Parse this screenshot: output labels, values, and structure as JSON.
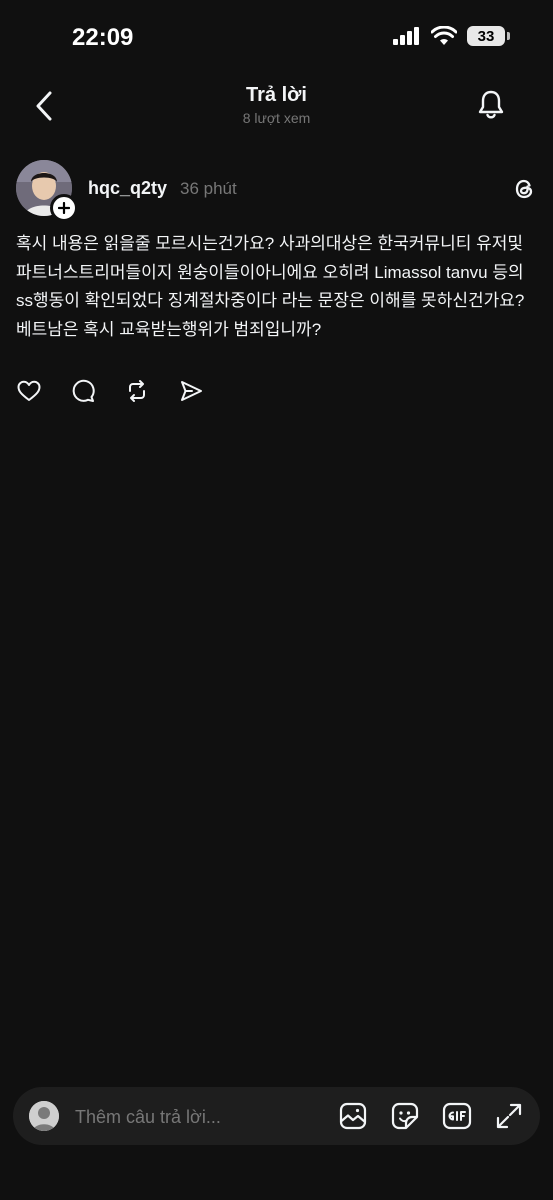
{
  "status_bar": {
    "time": "22:09",
    "battery": "33"
  },
  "header": {
    "title": "Trả lời",
    "subtitle": "8 lượt xem"
  },
  "post": {
    "username": "hqc_q2ty",
    "time": "36 phút",
    "text": "혹시 내용은 읽을줄 모르시는건가요? 사과의대상은 한국커뮤니티 유저및 파트너스트리머들이지 원숭이들이아니에요 오히려 Limassol tanvu 등의 ss행동이 확인되었다 징계절차중이다 라는 문장은 이해를 못하신건가요?\n베트남은 혹시 교육받는행위가 범죄입니까?"
  },
  "reply": {
    "placeholder": "Thêm câu trả lời..."
  },
  "icons": {
    "back": "chevron-left-icon",
    "bell": "bell-icon",
    "threads": "threads-logo-icon",
    "like": "heart-icon",
    "comment": "comment-icon",
    "repost": "repost-icon",
    "share": "send-icon",
    "image": "image-icon",
    "sticker": "sticker-icon",
    "gif": "gif-icon",
    "expand": "expand-icon"
  },
  "colors": {
    "background": "#101010",
    "text": "#f3f5f7",
    "muted": "#777777",
    "input_bg": "#1e1e1e"
  }
}
